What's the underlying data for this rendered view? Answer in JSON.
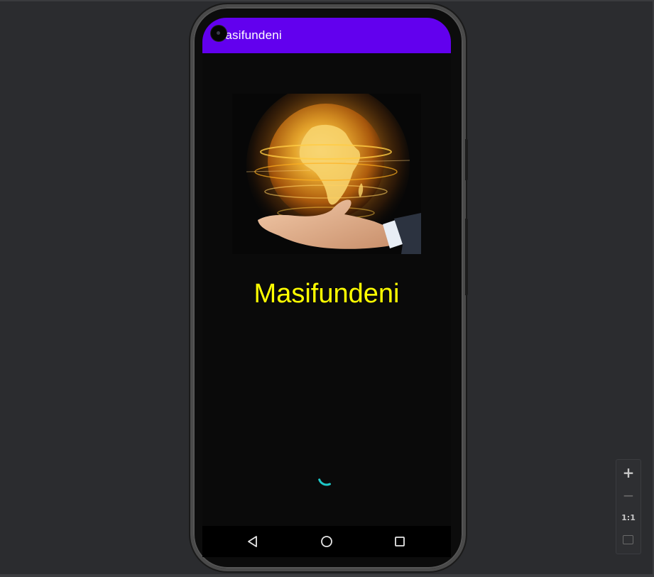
{
  "app": {
    "title": "Masifundeni",
    "brand_title": "Masifundeni",
    "app_bar_color": "#6200ee",
    "title_color": "#ffff00",
    "background_color": "#0a0a0a",
    "spinner_color": "#1ec8c8"
  },
  "hero": {
    "icon": "globe-in-hand-image"
  },
  "nav": {
    "back_icon": "back-triangle-icon",
    "home_icon": "home-circle-icon",
    "recents_icon": "recents-square-icon"
  },
  "zoom": {
    "zoom_in": "+",
    "zoom_out": "−",
    "actual_size": "1:1",
    "fit_icon": "fit-screen-icon"
  }
}
